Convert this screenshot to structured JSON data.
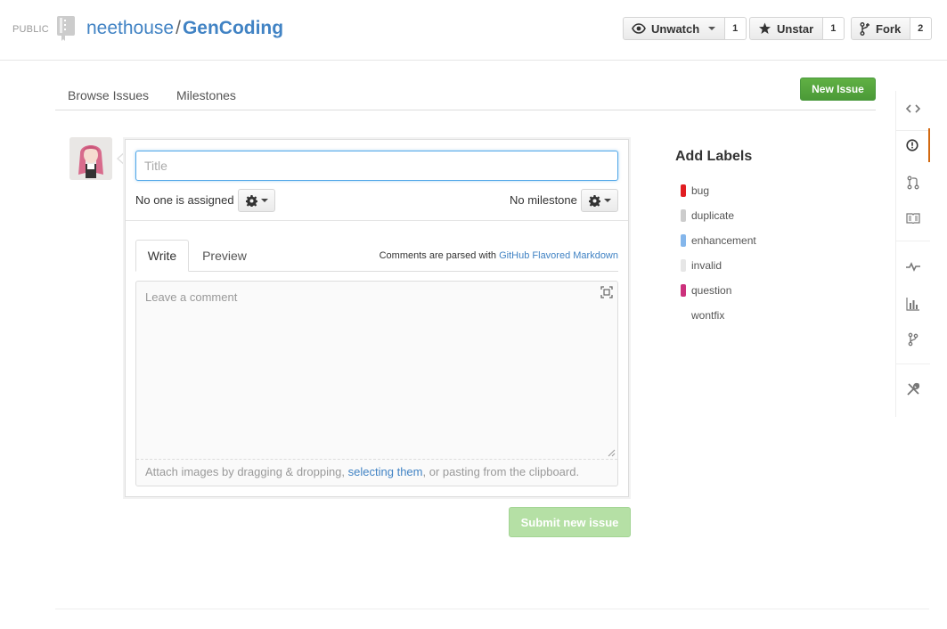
{
  "repo": {
    "visibility": "PUBLIC",
    "owner": "neethouse",
    "separator": "/",
    "name": "GenCoding"
  },
  "actions": {
    "watch": {
      "label": "Unwatch",
      "count": "1"
    },
    "star": {
      "label": "Unstar",
      "count": "1"
    },
    "fork": {
      "label": "Fork",
      "count": "2"
    }
  },
  "subnav": {
    "browse": "Browse Issues",
    "milestones": "Milestones",
    "new_issue": "New Issue"
  },
  "form": {
    "title_placeholder": "Title",
    "assignee": "No one is assigned",
    "milestone": "No milestone",
    "tabs": [
      "Write",
      "Preview"
    ],
    "markdown_note_prefix": "Comments are parsed with",
    "markdown_link": "GitHub Flavored Markdown",
    "comment_placeholder": "Leave a comment",
    "attach_prefix": "Attach images by dragging & dropping,",
    "attach_link": "selecting them",
    "attach_suffix": ", or pasting from the clipboard.",
    "submit": "Submit new issue"
  },
  "labels": {
    "title": "Add Labels",
    "items": [
      {
        "name": "bug",
        "color": "#e11d21"
      },
      {
        "name": "duplicate",
        "color": "#cccccc"
      },
      {
        "name": "enhancement",
        "color": "#84b6eb"
      },
      {
        "name": "invalid",
        "color": "#e6e6e6"
      },
      {
        "name": "question",
        "color": "#cc317c"
      },
      {
        "name": "wontfix",
        "color": "#ffffff"
      }
    ]
  },
  "rail": [
    "code-icon",
    "issues-icon",
    "pull-request-icon",
    "wiki-icon",
    "pulse-icon",
    "graphs-icon",
    "network-icon",
    "settings-icon"
  ],
  "colors": {
    "link": "#4183c4",
    "accent_green": "#4b9a37",
    "rail_selected": "#d26911"
  }
}
